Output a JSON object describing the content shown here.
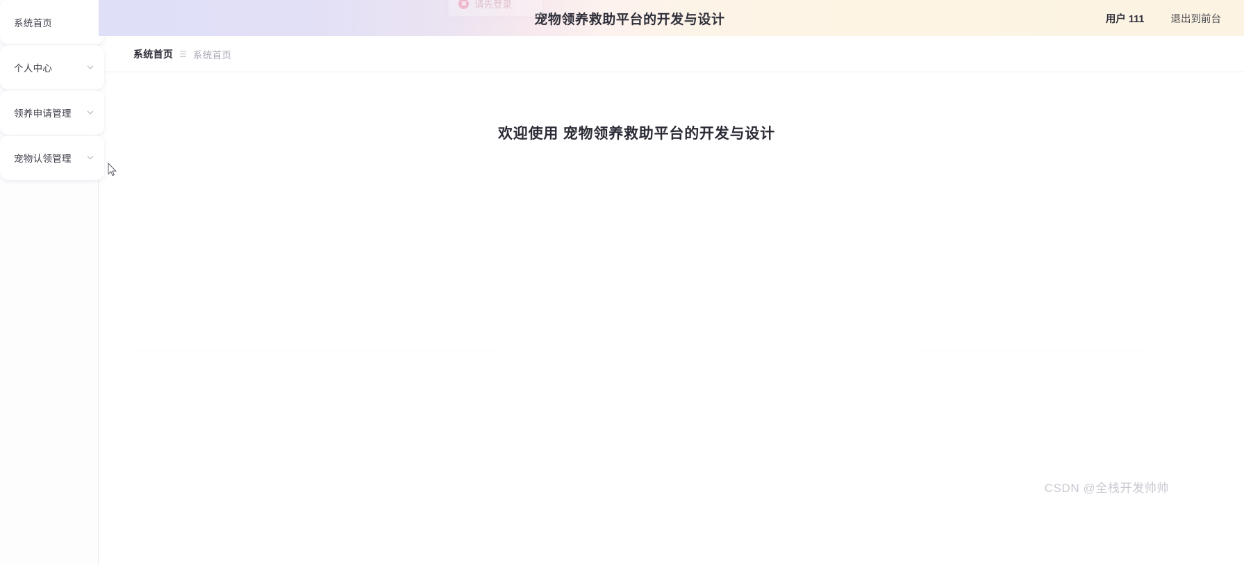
{
  "header": {
    "title": "宠物领养救助平台的开发与设计",
    "user_label": "用户 111",
    "logout_front_label": "退出到前台",
    "logout_label": "退出"
  },
  "toast": {
    "message": "请先登录",
    "icon": "close-circle-icon",
    "type": "error",
    "color": "#f07c9e"
  },
  "sidebar": {
    "items": [
      {
        "label": "系统首页",
        "has_children": false,
        "chevron": "chevron-down-icon"
      },
      {
        "label": "个人中心",
        "has_children": true,
        "chevron": "chevron-down-icon"
      },
      {
        "label": "领养申请管理",
        "has_children": true,
        "chevron": "chevron-down-icon"
      },
      {
        "label": "宠物认领管理",
        "has_children": true,
        "chevron": "chevron-down-icon"
      }
    ]
  },
  "breadcrumb": {
    "current": "系统首页",
    "separator": "☰",
    "item": "系统首页"
  },
  "main": {
    "welcome_text": "欢迎使用 宠物领养救助平台的开发与设计"
  },
  "watermark": {
    "text": "CSDN @全栈开发帅帅"
  },
  "theme": {
    "header_gradient_left": "#dfdff8",
    "header_gradient_mid": "#fdf2ee",
    "header_gradient_right": "#fcf3e2",
    "text_primary": "#2f2f3a",
    "text_muted": "#a7a7b4"
  }
}
